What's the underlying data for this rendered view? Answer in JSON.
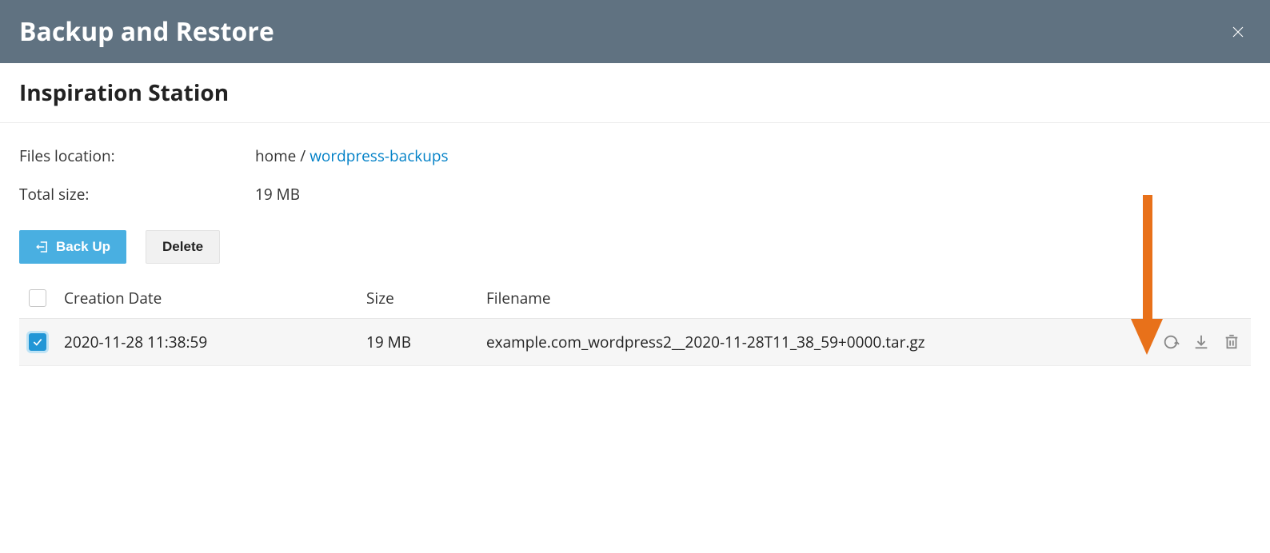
{
  "modal": {
    "title": "Backup and Restore"
  },
  "subheader": {
    "title": "Inspiration Station"
  },
  "info": {
    "files_location_label": "Files location:",
    "files_location_prefix": "home / ",
    "files_location_link": "wordpress-backups",
    "total_size_label": "Total size:",
    "total_size_value": "19 MB"
  },
  "buttons": {
    "back_up": "Back Up",
    "delete": "Delete"
  },
  "table": {
    "columns": {
      "creation_date": "Creation Date",
      "size": "Size",
      "filename": "Filename"
    },
    "rows": [
      {
        "checked": true,
        "date": "2020-11-28 11:38:59",
        "size": "19 MB",
        "filename": "example.com_wordpress2__2020-11-28T11_38_59+0000.tar.gz"
      }
    ]
  }
}
